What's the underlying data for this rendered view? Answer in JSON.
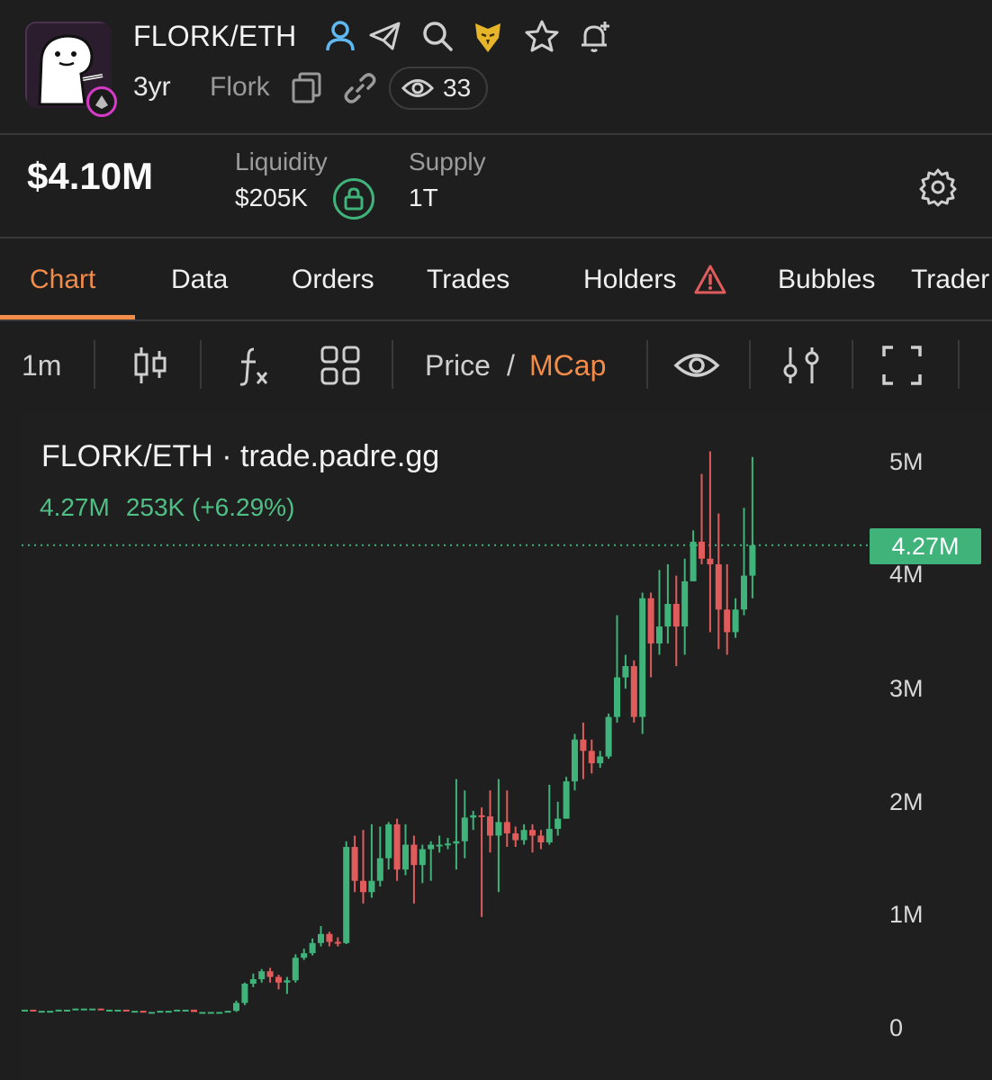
{
  "header": {
    "pair": "FLORK/ETH",
    "age": "3yr",
    "token_name": "Flork",
    "watchers": "33"
  },
  "stats": {
    "market_cap": "$4.10M",
    "liquidity_label": "Liquidity",
    "liquidity_value": "$205K",
    "supply_label": "Supply",
    "supply_value": "1T"
  },
  "tabs": [
    {
      "label": "Chart",
      "active": true
    },
    {
      "label": "Data"
    },
    {
      "label": "Orders"
    },
    {
      "label": "Trades"
    },
    {
      "label": "Holders"
    },
    {
      "label": "Bubbles"
    },
    {
      "label": "Trader"
    }
  ],
  "toolbar": {
    "interval": "1m",
    "price_label": "Price",
    "slash": "/",
    "mcap_label": "MCap"
  },
  "chart": {
    "title": "FLORK/ETH · trade.padre.gg",
    "last_value": "4.27M",
    "change": "253K (+6.29%)",
    "price_tag": "4.27M"
  },
  "colors": {
    "up": "#3fb37a",
    "down": "#e05c5c",
    "accent": "#f28c4a",
    "background": "#1e1e1e"
  },
  "chart_data": {
    "type": "candlestick",
    "y_tick_labels": [
      "5M",
      "4M",
      "3M",
      "2M",
      "1M",
      "0"
    ],
    "y_ticks": [
      5000000,
      4000000,
      3000000,
      2000000,
      1000000,
      0
    ],
    "ylim": [
      0,
      5200000
    ],
    "last_price_line": 4270000,
    "candles": [
      {
        "o": 0.16,
        "c": 0.16,
        "h": 0.16,
        "l": 0.16
      },
      {
        "o": 0.16,
        "c": 0.15,
        "h": 0.16,
        "l": 0.15
      },
      {
        "o": 0.15,
        "c": 0.15,
        "h": 0.15,
        "l": 0.15
      },
      {
        "o": 0.15,
        "c": 0.15,
        "h": 0.15,
        "l": 0.15
      },
      {
        "o": 0.15,
        "c": 0.16,
        "h": 0.16,
        "l": 0.15
      },
      {
        "o": 0.16,
        "c": 0.16,
        "h": 0.16,
        "l": 0.16
      },
      {
        "o": 0.16,
        "c": 0.17,
        "h": 0.17,
        "l": 0.16
      },
      {
        "o": 0.17,
        "c": 0.17,
        "h": 0.17,
        "l": 0.17
      },
      {
        "o": 0.17,
        "c": 0.17,
        "h": 0.17,
        "l": 0.17
      },
      {
        "o": 0.17,
        "c": 0.16,
        "h": 0.17,
        "l": 0.16
      },
      {
        "o": 0.16,
        "c": 0.16,
        "h": 0.16,
        "l": 0.16
      },
      {
        "o": 0.16,
        "c": 0.16,
        "h": 0.16,
        "l": 0.16
      },
      {
        "o": 0.16,
        "c": 0.15,
        "h": 0.16,
        "l": 0.15
      },
      {
        "o": 0.15,
        "c": 0.15,
        "h": 0.15,
        "l": 0.15
      },
      {
        "o": 0.15,
        "c": 0.14,
        "h": 0.15,
        "l": 0.14
      },
      {
        "o": 0.14,
        "c": 0.14,
        "h": 0.14,
        "l": 0.14
      },
      {
        "o": 0.14,
        "c": 0.15,
        "h": 0.15,
        "l": 0.14
      },
      {
        "o": 0.15,
        "c": 0.15,
        "h": 0.15,
        "l": 0.15
      },
      {
        "o": 0.15,
        "c": 0.16,
        "h": 0.16,
        "l": 0.15
      },
      {
        "o": 0.16,
        "c": 0.16,
        "h": 0.16,
        "l": 0.16
      },
      {
        "o": 0.16,
        "c": 0.14,
        "h": 0.16,
        "l": 0.14
      },
      {
        "o": 0.14,
        "c": 0.14,
        "h": 0.14,
        "l": 0.14
      },
      {
        "o": 0.14,
        "c": 0.14,
        "h": 0.14,
        "l": 0.14
      },
      {
        "o": 0.14,
        "c": 0.14,
        "h": 0.14,
        "l": 0.14
      },
      {
        "o": 0.14,
        "c": 0.15,
        "h": 0.15,
        "l": 0.14
      },
      {
        "o": 0.15,
        "c": 0.22,
        "h": 0.24,
        "l": 0.14
      },
      {
        "o": 0.22,
        "c": 0.39,
        "h": 0.4,
        "l": 0.2
      },
      {
        "o": 0.39,
        "c": 0.43,
        "h": 0.48,
        "l": 0.36
      },
      {
        "o": 0.43,
        "c": 0.5,
        "h": 0.52,
        "l": 0.4
      },
      {
        "o": 0.5,
        "c": 0.45,
        "h": 0.53,
        "l": 0.4
      },
      {
        "o": 0.45,
        "c": 0.4,
        "h": 0.47,
        "l": 0.34
      },
      {
        "o": 0.4,
        "c": 0.42,
        "h": 0.45,
        "l": 0.3
      },
      {
        "o": 0.42,
        "c": 0.62,
        "h": 0.65,
        "l": 0.4
      },
      {
        "o": 0.62,
        "c": 0.66,
        "h": 0.7,
        "l": 0.6
      },
      {
        "o": 0.66,
        "c": 0.75,
        "h": 0.79,
        "l": 0.64
      },
      {
        "o": 0.75,
        "c": 0.83,
        "h": 0.9,
        "l": 0.72
      },
      {
        "o": 0.83,
        "c": 0.76,
        "h": 0.85,
        "l": 0.72
      },
      {
        "o": 0.76,
        "c": 0.75,
        "h": 0.8,
        "l": 0.72
      },
      {
        "o": 0.75,
        "c": 1.6,
        "h": 1.65,
        "l": 0.74
      },
      {
        "o": 1.6,
        "c": 1.3,
        "h": 1.7,
        "l": 1.2
      },
      {
        "o": 1.3,
        "c": 1.2,
        "h": 1.75,
        "l": 1.1
      },
      {
        "o": 1.2,
        "c": 1.3,
        "h": 1.8,
        "l": 1.15
      },
      {
        "o": 1.3,
        "c": 1.5,
        "h": 1.78,
        "l": 1.25
      },
      {
        "o": 1.5,
        "c": 1.8,
        "h": 1.82,
        "l": 1.4
      },
      {
        "o": 1.8,
        "c": 1.4,
        "h": 1.85,
        "l": 1.3
      },
      {
        "o": 1.4,
        "c": 1.62,
        "h": 1.8,
        "l": 1.35
      },
      {
        "o": 1.62,
        "c": 1.44,
        "h": 1.7,
        "l": 1.1
      },
      {
        "o": 1.44,
        "c": 1.58,
        "h": 1.62,
        "l": 1.28
      },
      {
        "o": 1.58,
        "c": 1.62,
        "h": 1.65,
        "l": 1.3
      },
      {
        "o": 1.62,
        "c": 1.62,
        "h": 1.7,
        "l": 1.55
      },
      {
        "o": 1.62,
        "c": 1.63,
        "h": 1.68,
        "l": 1.58
      },
      {
        "o": 1.63,
        "c": 1.65,
        "h": 2.2,
        "l": 1.4
      },
      {
        "o": 1.65,
        "c": 1.86,
        "h": 2.1,
        "l": 1.5
      },
      {
        "o": 1.86,
        "c": 1.88,
        "h": 1.92,
        "l": 1.75
      },
      {
        "o": 1.88,
        "c": 1.87,
        "h": 1.95,
        "l": 0.98
      },
      {
        "o": 1.87,
        "c": 1.7,
        "h": 2.1,
        "l": 1.55
      },
      {
        "o": 1.7,
        "c": 1.82,
        "h": 2.2,
        "l": 1.2
      },
      {
        "o": 1.82,
        "c": 1.72,
        "h": 2.1,
        "l": 1.6
      },
      {
        "o": 1.72,
        "c": 1.66,
        "h": 1.78,
        "l": 1.6
      },
      {
        "o": 1.66,
        "c": 1.75,
        "h": 1.8,
        "l": 1.62
      },
      {
        "o": 1.75,
        "c": 1.7,
        "h": 1.8,
        "l": 1.55
      },
      {
        "o": 1.7,
        "c": 1.64,
        "h": 1.75,
        "l": 1.58
      },
      {
        "o": 1.64,
        "c": 1.76,
        "h": 2.15,
        "l": 1.62
      },
      {
        "o": 1.76,
        "c": 1.85,
        "h": 2.0,
        "l": 1.7
      },
      {
        "o": 1.85,
        "c": 2.18,
        "h": 2.22,
        "l": 1.85
      },
      {
        "o": 2.18,
        "c": 2.55,
        "h": 2.6,
        "l": 2.1
      },
      {
        "o": 2.55,
        "c": 2.45,
        "h": 2.7,
        "l": 2.2
      },
      {
        "o": 2.45,
        "c": 2.34,
        "h": 2.55,
        "l": 2.25
      },
      {
        "o": 2.34,
        "c": 2.4,
        "h": 2.45,
        "l": 2.3
      },
      {
        "o": 2.4,
        "c": 2.75,
        "h": 2.78,
        "l": 2.38
      },
      {
        "o": 2.75,
        "c": 3.1,
        "h": 3.65,
        "l": 2.7
      },
      {
        "o": 3.1,
        "c": 3.2,
        "h": 3.3,
        "l": 3.0
      },
      {
        "o": 3.2,
        "c": 2.75,
        "h": 3.25,
        "l": 2.7
      },
      {
        "o": 2.75,
        "c": 3.8,
        "h": 3.85,
        "l": 2.6
      },
      {
        "o": 3.8,
        "c": 3.4,
        "h": 3.85,
        "l": 3.1
      },
      {
        "o": 3.4,
        "c": 3.55,
        "h": 4.05,
        "l": 3.3
      },
      {
        "o": 3.55,
        "c": 3.75,
        "h": 4.1,
        "l": 3.4
      },
      {
        "o": 3.75,
        "c": 3.55,
        "h": 4.0,
        "l": 3.2
      },
      {
        "o": 3.55,
        "c": 3.95,
        "h": 4.15,
        "l": 3.3
      },
      {
        "o": 3.95,
        "c": 4.3,
        "h": 4.4,
        "l": 3.95
      },
      {
        "o": 4.3,
        "c": 4.15,
        "h": 4.9,
        "l": 4.1
      },
      {
        "o": 4.15,
        "c": 4.1,
        "h": 5.1,
        "l": 3.5
      },
      {
        "o": 4.1,
        "c": 3.7,
        "h": 4.55,
        "l": 3.35
      },
      {
        "o": 3.7,
        "c": 3.5,
        "h": 4.1,
        "l": 3.3
      },
      {
        "o": 3.5,
        "c": 3.7,
        "h": 3.8,
        "l": 3.45
      },
      {
        "o": 3.7,
        "c": 4.0,
        "h": 4.6,
        "l": 3.65
      },
      {
        "o": 4.0,
        "c": 4.27,
        "h": 5.05,
        "l": 3.8
      }
    ]
  }
}
